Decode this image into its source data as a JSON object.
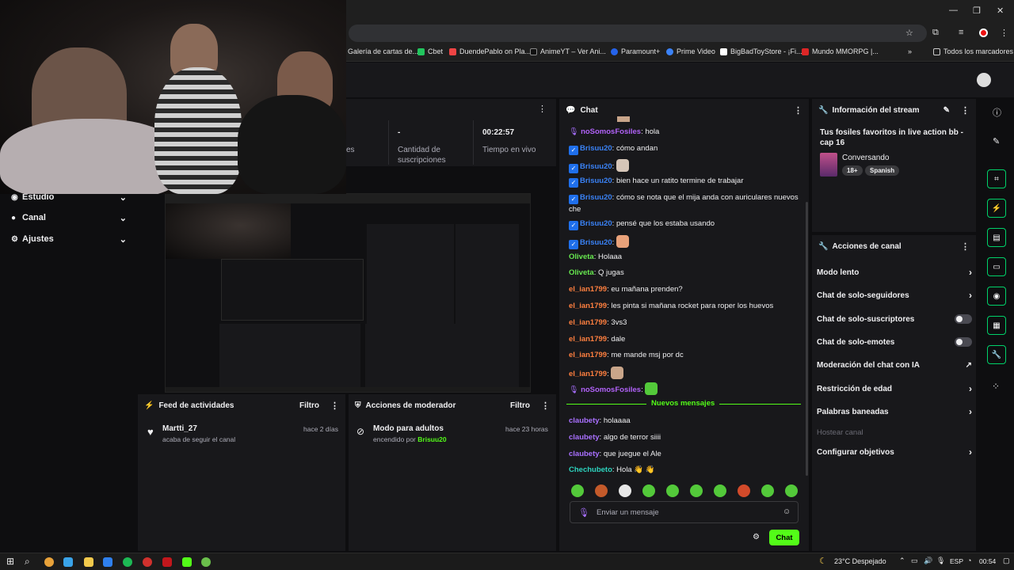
{
  "bookmarks": [
    {
      "label": "Galería de cartas de...",
      "color": "#3b82f6"
    },
    {
      "label": "Cbet",
      "color": "#22c55e"
    },
    {
      "label": "DuendePablo on Pla...",
      "color": "#ef4444"
    },
    {
      "label": "AnimeYT – Ver Ani...",
      "color": "#111111"
    },
    {
      "label": "Paramount+",
      "color": "#2563eb"
    },
    {
      "label": "Prime Video",
      "color": "#3b82f6"
    },
    {
      "label": "BigBadToyStore - ¡Fi...",
      "color": "#ffffff"
    },
    {
      "label": "Mundo MMORPG |...",
      "color": "#dc2626"
    }
  ],
  "bookmarks_more": "»",
  "bookmarks_all": "Todos los marcadores",
  "leftnav": {
    "items": [
      {
        "label": "Estudio"
      },
      {
        "label": "Canal"
      },
      {
        "label": "Ajustes"
      }
    ]
  },
  "stats": {
    "partial_label": "es",
    "subs_value": "-",
    "subs_label": "Cantidad de suscripciones",
    "time_value": "00:22:57",
    "time_label": "Tiempo en vivo"
  },
  "feed": {
    "title": "Feed de actividades",
    "filter": "Filtro",
    "items": [
      {
        "user": "Martti_27",
        "detail": "acaba de seguir el canal",
        "time": "hace 2 días"
      }
    ]
  },
  "modactions": {
    "title": "Acciones de moderador",
    "filter": "Filtro",
    "items": [
      {
        "title": "Modo para adultos",
        "detail_prefix": "encendido por",
        "user": "Brisuu20",
        "time": "hace 23 horas"
      }
    ]
  },
  "chat": {
    "title": "Chat",
    "messages": [
      {
        "user": "noSomosFosiles",
        "text": "hola",
        "cls": "u-purple",
        "badge": "mic"
      },
      {
        "user": "Brisuu20",
        "text": "cómo andan",
        "cls": "u-blue",
        "badge": "sq"
      },
      {
        "user": "Brisuu20",
        "text": "",
        "cls": "u-blue",
        "badge": "sq",
        "emote": "#d6c6b8"
      },
      {
        "user": "Brisuu20",
        "text": "bien hace un ratito termine de trabajar",
        "cls": "u-blue",
        "badge": "sq"
      },
      {
        "user": "Brisuu20",
        "text": "cómo se nota que el mija anda con auriculares nuevos",
        "cls": "u-blue",
        "badge": "sq",
        "cont": "che"
      },
      {
        "user": "Brisuu20",
        "text": "pensé que los estaba usando",
        "cls": "u-blue",
        "badge": "sq"
      },
      {
        "user": "Brisuu20",
        "text": "",
        "cls": "u-blue",
        "badge": "sq",
        "emote": "#e9a27a"
      },
      {
        "user": "Oliveta",
        "text": "Holaaa",
        "cls": "u-green",
        "badge": ""
      },
      {
        "user": "Oliveta",
        "text": "Q jugas",
        "cls": "u-green",
        "badge": ""
      },
      {
        "user": "el_ian1799",
        "text": "eu mañana prenden?",
        "cls": "u-orange",
        "badge": ""
      },
      {
        "user": "el_ian1799",
        "text": "les pinta si mañana rocket para roper los huevos",
        "cls": "u-orange",
        "badge": ""
      },
      {
        "user": "el_ian1799",
        "text": "3vs3",
        "cls": "u-orange",
        "badge": ""
      },
      {
        "user": "el_ian1799",
        "text": "dale",
        "cls": "u-orange",
        "badge": ""
      },
      {
        "user": "el_ian1799",
        "text": "me mande msj por dc",
        "cls": "u-orange",
        "badge": ""
      },
      {
        "user": "el_ian1799",
        "text": "",
        "cls": "u-orange",
        "badge": "",
        "emote": "#c9a58a"
      },
      {
        "user": "noSomosFosiles",
        "text": "",
        "cls": "u-purple",
        "badge": "mic",
        "emote": "#53c93a"
      }
    ],
    "new_messages": "Nuevos mensajes",
    "messages_new": [
      {
        "user": "claubety",
        "text": "holaaaa",
        "cls": "u-violet"
      },
      {
        "user": "claubety",
        "text": "algo de terror siiii",
        "cls": "u-violet"
      },
      {
        "user": "claubety",
        "text": "que juegue el Ale",
        "cls": "u-violet"
      },
      {
        "user": "Chechubeto",
        "text": "Hola 👋 👋",
        "cls": "u-teal"
      }
    ],
    "input_placeholder": "Enviar un mensaje",
    "send_label": "Chat"
  },
  "stream_info": {
    "title": "Información del stream",
    "stream_title": "Tus fosiles favoritos in live action bb - cap 16",
    "category": "Conversando",
    "tags": [
      "18+",
      "Spanish"
    ]
  },
  "channel_actions": {
    "title": "Acciones de canal",
    "items": [
      {
        "label": "Modo lento",
        "kind": "arrow"
      },
      {
        "label": "Chat de solo-seguidores",
        "kind": "arrow"
      },
      {
        "label": "Chat de solo-suscriptores",
        "kind": "toggle"
      },
      {
        "label": "Chat de solo-emotes",
        "kind": "toggle"
      },
      {
        "label": "Moderación del chat con IA",
        "kind": "external"
      },
      {
        "label": "Restricción de edad",
        "kind": "arrow"
      },
      {
        "label": "Palabras baneadas",
        "kind": "arrow"
      },
      {
        "label": "Hostear canal",
        "kind": "disabled"
      },
      {
        "label": "Configurar objetivos",
        "kind": "arrow"
      }
    ]
  },
  "taskbar": {
    "weather": "23°C Despejado",
    "lang": "ESP",
    "time": "00:54"
  },
  "colors": {
    "accent": "#53fc18",
    "panel": "#18181b",
    "bg": "#0e0e10"
  }
}
